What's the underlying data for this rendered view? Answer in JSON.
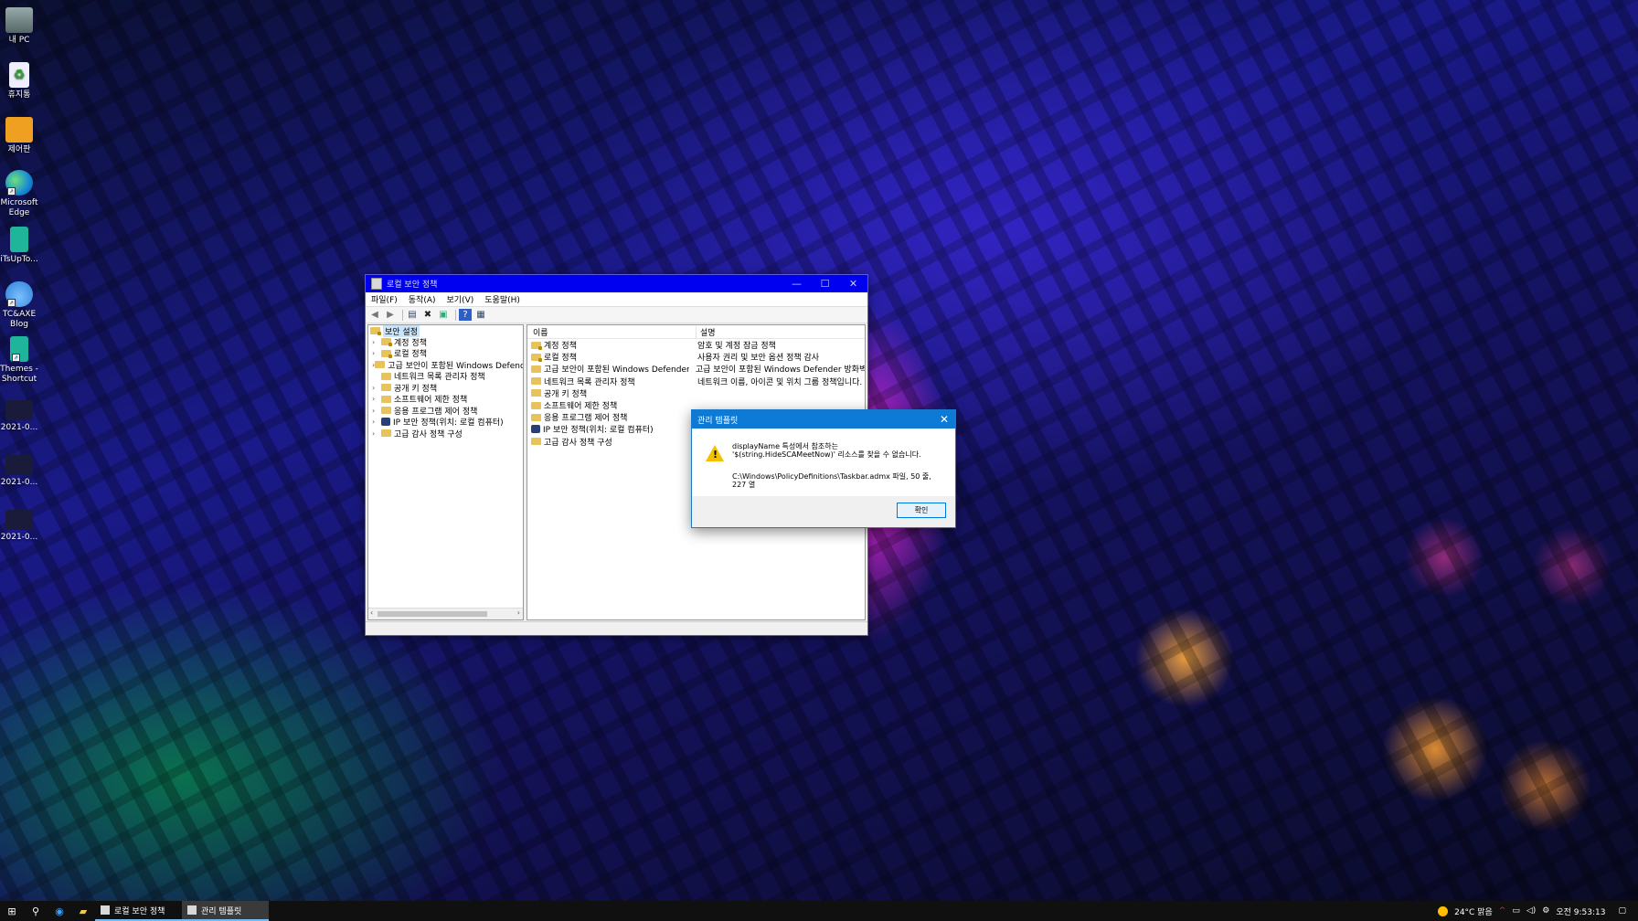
{
  "desktop": {
    "icons": [
      {
        "label": "내 PC",
        "icon": "computer-icon"
      },
      {
        "label": "휴지통",
        "icon": "recycle-bin-icon"
      },
      {
        "label": "제어판",
        "icon": "control-panel-icon"
      },
      {
        "label": "Microsoft Edge",
        "icon": "edge-icon"
      },
      {
        "label": "iTsUpTo...",
        "icon": "book-icon"
      },
      {
        "label": "TC&AXE Blog",
        "icon": "cloud-icon"
      },
      {
        "label": "Themes - Shortcut",
        "icon": "book-icon"
      },
      {
        "label": "2021-0...",
        "icon": "video-icon"
      },
      {
        "label": "2021-0...",
        "icon": "video-icon"
      },
      {
        "label": "2021-0...",
        "icon": "video-icon"
      }
    ]
  },
  "window": {
    "title": "로컬 보안 정책",
    "menu": [
      "파일(F)",
      "동작(A)",
      "보기(V)",
      "도움말(H)"
    ],
    "tree": {
      "root": "보안 설정",
      "items": [
        {
          "label": "계정 정책",
          "icon": "folder"
        },
        {
          "label": "로컬 정책",
          "icon": "folder"
        },
        {
          "label": "고급 보안이 포함된 Windows Defender",
          "icon": "folder"
        },
        {
          "label": "네트워크 목록 관리자 정책",
          "icon": "folder"
        },
        {
          "label": "공개 키 정책",
          "icon": "folder"
        },
        {
          "label": "소프트웨어 제한 정책",
          "icon": "folder"
        },
        {
          "label": "응용 프로그램 제어 정책",
          "icon": "folder"
        },
        {
          "label": "IP 보안 정책(위치: 로컬 컴퓨터)",
          "icon": "ipsec"
        },
        {
          "label": "고급 감사 정책 구성",
          "icon": "folder"
        }
      ]
    },
    "list": {
      "col_name": "이름",
      "col_desc": "설명",
      "rows": [
        {
          "name": "계정 정책",
          "desc": "암호 및 계정 잠금 정책"
        },
        {
          "name": "로컬 정책",
          "desc": "사용자 권리 및 보안 옵션 정책 감사"
        },
        {
          "name": "고급 보안이 포함된 Windows Defender ...",
          "desc": "고급 보안이 포함된 Windows Defender 방화벽"
        },
        {
          "name": "네트워크 목록 관리자 정책",
          "desc": "네트워크 이름, 아이콘 및 위치 그룹 정책입니다."
        },
        {
          "name": "공개 키 정책",
          "desc": ""
        },
        {
          "name": "소프트웨어 제한 정책",
          "desc": ""
        },
        {
          "name": "응용 프로그램 제어 정책",
          "desc": ""
        },
        {
          "name": "IP 보안 정책(위치: 로컬 컴퓨터)",
          "desc": ""
        },
        {
          "name": "고급 감사 정책 구성",
          "desc": ""
        }
      ]
    }
  },
  "dialog": {
    "title": "관리 템플릿",
    "message": "displayName 특성에서 참조하는 '$(string.HideSCAMeetNow)' 리소스를 찾을 수 없습니다.",
    "path": "C:\\Windows\\PolicyDefinitions\\Taskbar.admx 파일, 50 줄, 227 열",
    "ok_label": "확인"
  },
  "taskbar": {
    "tasks": [
      "로컬 보안 정책",
      "관리 템플릿"
    ],
    "weather": "24°C 맑음",
    "clock": "오전 9:53:13",
    "accent": "#0d7ad6"
  }
}
